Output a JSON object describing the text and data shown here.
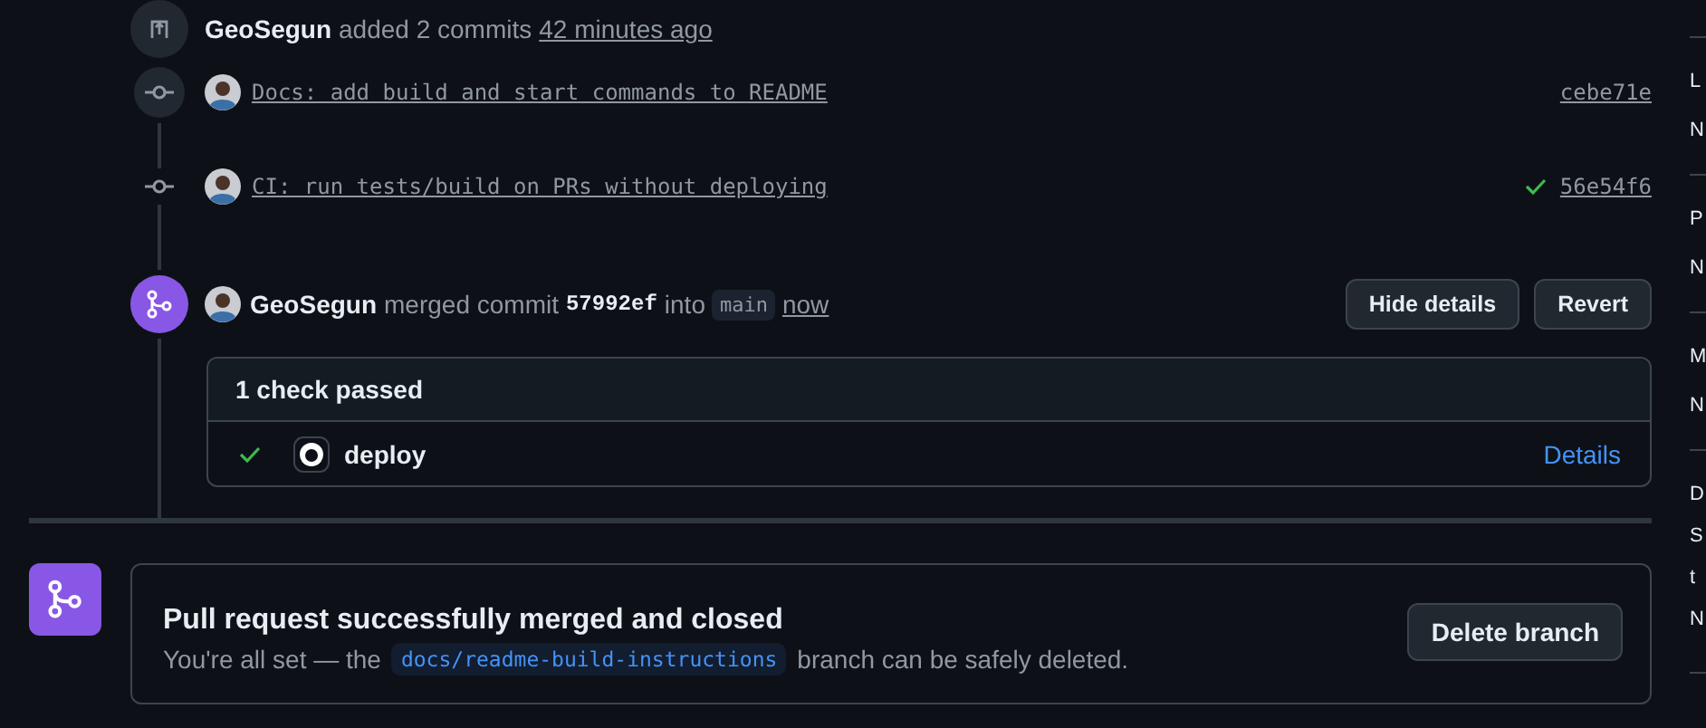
{
  "timeline_event": {
    "author": "GeoSegun",
    "action": "added 2 commits",
    "time": "42 minutes ago"
  },
  "commits": [
    {
      "message": "Docs: add build and start commands to README",
      "sha": "cebe71e",
      "passed": false,
      "badge": true
    },
    {
      "message": "CI: run tests/build on PRs without deploying",
      "sha": "56e54f6",
      "passed": true,
      "badge": false
    }
  ],
  "merge_event": {
    "author": "GeoSegun",
    "action": "merged commit",
    "commit": "57992ef",
    "connector": "into",
    "branch": "main",
    "time": "now",
    "buttons": [
      "Hide details",
      "Revert"
    ]
  },
  "checks": {
    "summary": "1 check passed",
    "items": [
      {
        "name": "deploy",
        "passed": true,
        "link": "Details"
      }
    ]
  },
  "merged_banner": {
    "title": "Pull request successfully merged and closed",
    "message_before": "You're all set — the",
    "branch": "docs/readme-build-instructions",
    "message_after": "branch can be safely deleted.",
    "button": "Delete branch"
  },
  "sidebar": {
    "sections": [
      {
        "lines": [
          "L",
          "N"
        ]
      },
      {
        "lines": [
          "P",
          "N"
        ]
      },
      {
        "lines": [
          "M",
          "N"
        ]
      },
      {
        "lines": [
          "D",
          "S",
          "t",
          "N"
        ]
      }
    ]
  }
}
